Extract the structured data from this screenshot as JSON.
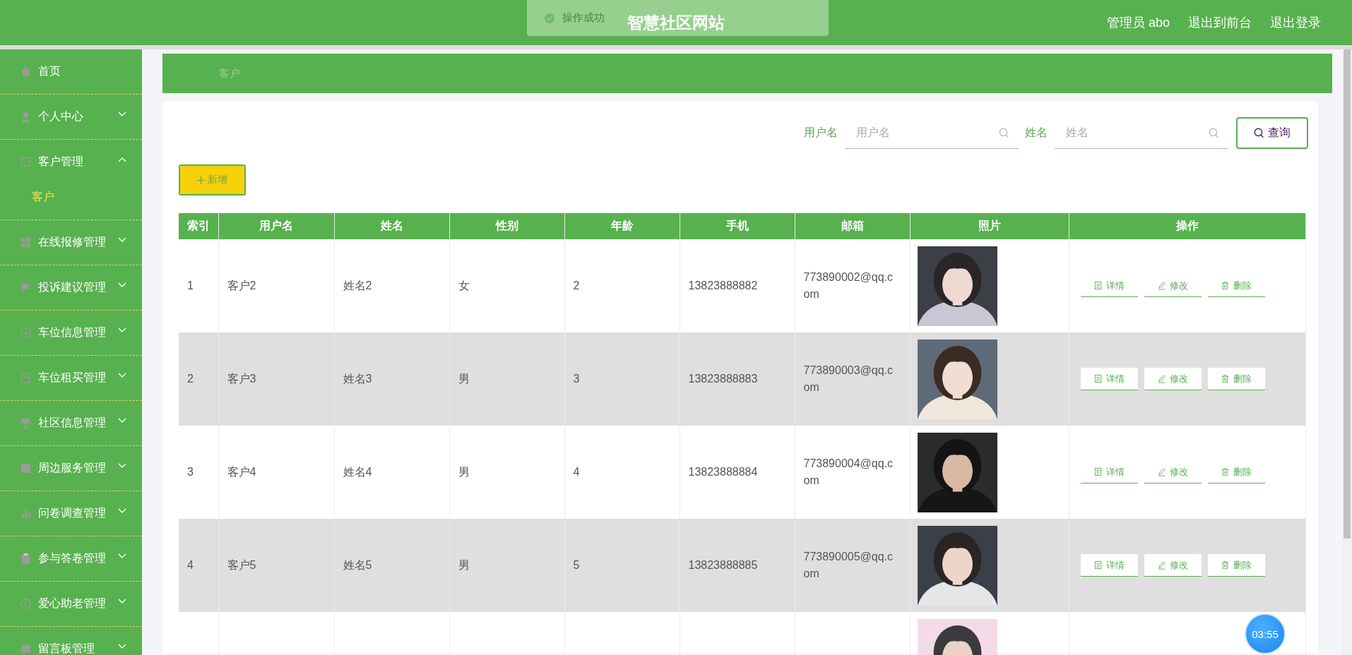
{
  "header": {
    "title": "智慧社区网站",
    "user": "管理员 abo",
    "links": [
      "退出到前台",
      "退出登录"
    ]
  },
  "toast": {
    "message": "操作成功"
  },
  "sidebar": {
    "items": [
      {
        "label": "首页",
        "kind": "link"
      },
      {
        "label": "个人中心",
        "kind": "menu",
        "expanded": false
      },
      {
        "label": "客户管理",
        "kind": "menu",
        "expanded": true,
        "children": [
          {
            "label": "客户",
            "selected": true
          }
        ]
      },
      {
        "label": "在线报修管理",
        "kind": "menu",
        "expanded": false
      },
      {
        "label": "投诉建议管理",
        "kind": "menu",
        "expanded": false
      },
      {
        "label": "车位信息管理",
        "kind": "menu",
        "expanded": false
      },
      {
        "label": "车位租买管理",
        "kind": "menu",
        "expanded": false
      },
      {
        "label": "社区信息管理",
        "kind": "menu",
        "expanded": false
      },
      {
        "label": "周边服务管理",
        "kind": "menu",
        "expanded": false
      },
      {
        "label": "问卷调查管理",
        "kind": "menu",
        "expanded": false
      },
      {
        "label": "参与答卷管理",
        "kind": "menu",
        "expanded": false
      },
      {
        "label": "爱心助老管理",
        "kind": "menu",
        "expanded": false
      },
      {
        "label": "留言板管理",
        "kind": "menu",
        "expanded": false
      }
    ]
  },
  "breadcrumb": [
    "客户"
  ],
  "search": {
    "fields": [
      {
        "label": "用户名",
        "placeholder": "用户名"
      },
      {
        "label": "姓名",
        "placeholder": "姓名"
      }
    ],
    "button": "查询"
  },
  "add_button": "新增",
  "table": {
    "columns": [
      "索引",
      "用户名",
      "姓名",
      "性别",
      "年龄",
      "手机",
      "邮箱",
      "照片",
      "操作"
    ],
    "rows": [
      {
        "index": "1",
        "username": "客户2",
        "name": "姓名2",
        "gender": "女",
        "age": "2",
        "phone": "13823888882",
        "email": "773890002@qq.com",
        "photo": {
          "kind": "picture"
        },
        "actions": [
          "详情",
          "修改",
          "删除"
        ]
      },
      {
        "index": "2",
        "username": "客户3",
        "name": "姓名3",
        "gender": "男",
        "age": "3",
        "phone": "13823888883",
        "email": "773890003@qq.com",
        "photo": {
          "kind": "picture"
        },
        "actions": [
          "详情",
          "修改",
          "删除"
        ]
      },
      {
        "index": "3",
        "username": "客户4",
        "name": "姓名4",
        "gender": "男",
        "age": "4",
        "phone": "13823888884",
        "email": "773890004@qq.com",
        "photo": {
          "kind": "picture"
        },
        "actions": [
          "详情",
          "修改",
          "删除"
        ]
      },
      {
        "index": "4",
        "username": "客户5",
        "name": "姓名5",
        "gender": "男",
        "age": "5",
        "phone": "13823888885",
        "email": "773890005@qq.com",
        "photo": {
          "kind": "picture"
        },
        "actions": [
          "详情",
          "修改",
          "删除"
        ]
      },
      {
        "photo": {
          "kind": "picture"
        }
      }
    ]
  },
  "timer": "03:55"
}
